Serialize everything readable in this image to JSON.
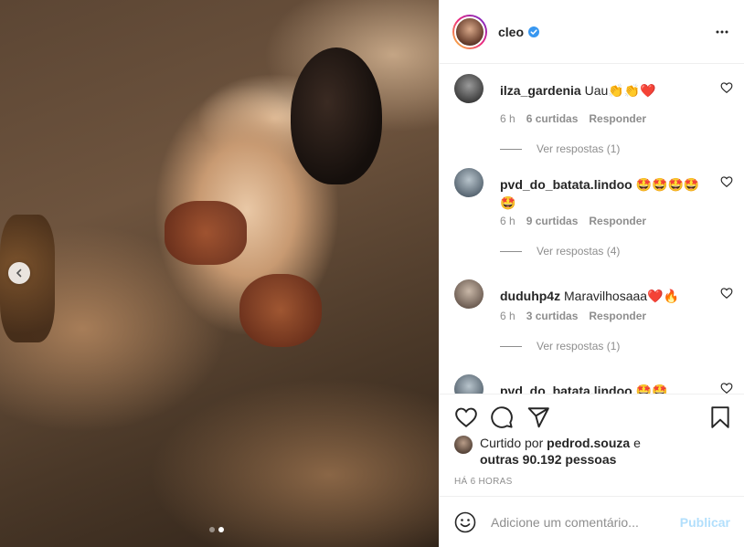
{
  "post": {
    "username": "cleo",
    "verified": true,
    "carousel": {
      "dots": 2,
      "active_index": 1
    }
  },
  "comments": [
    {
      "user": "ilza_gardenia",
      "text": "Uau👏👏❤️",
      "time": "6 h",
      "likes": "6 curtidas",
      "reply_label": "Responder",
      "replies": "Ver respostas (1)"
    },
    {
      "user": "pvd_do_batata.lindoo",
      "text": "🤩🤩🤩🤩🤩",
      "time": "6 h",
      "likes": "9 curtidas",
      "reply_label": "Responder",
      "replies": "Ver respostas (4)"
    },
    {
      "user": "duduhp4z",
      "text": "Maravilhosaaa❤️🔥",
      "time": "6 h",
      "likes": "3 curtidas",
      "reply_label": "Responder",
      "replies": "Ver respostas (1)"
    },
    {
      "user": "pvd_do_batata.lindoo",
      "text": "🤩🤩"
    }
  ],
  "likes": {
    "prefix": "Curtido por",
    "user": "pedrod.souza",
    "suffix": "e",
    "others": "outras 90.192 pessoas"
  },
  "timestamp": "HÁ 6 HORAS",
  "add_comment": {
    "placeholder": "Adicione um comentário...",
    "post_label": "Publicar"
  },
  "icons": {
    "like": "heart-icon",
    "comment": "comment-icon",
    "share": "paper-plane-icon",
    "save": "bookmark-icon",
    "more": "more-dots-icon",
    "emoji": "emoji-icon",
    "prev": "chevron-left-icon"
  },
  "colors": {
    "verified": "#3897f0",
    "publish_disabled": "#b2dffc",
    "muted_text": "#8e8e8e"
  }
}
